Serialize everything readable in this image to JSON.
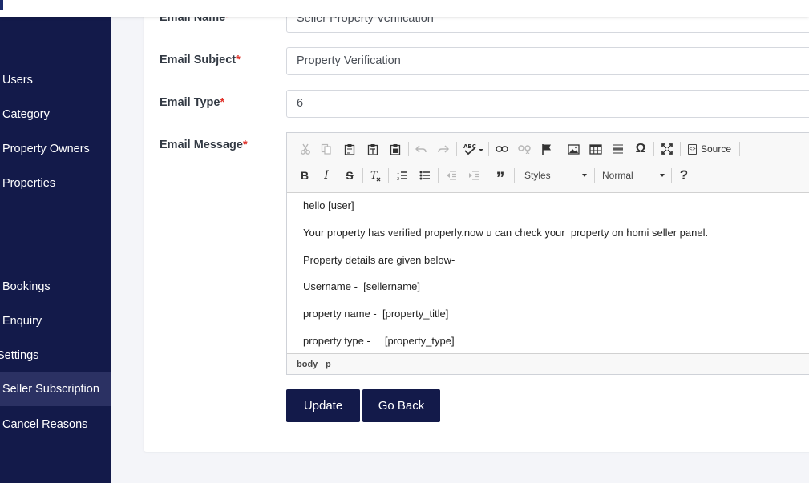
{
  "sidebar": {
    "items": [
      {
        "label": "Users"
      },
      {
        "label": "Category"
      },
      {
        "label": "Property Owners"
      },
      {
        "label": "Properties"
      },
      {
        "label": "Bookings"
      },
      {
        "label": "Enquiry"
      },
      {
        "label": "Settings"
      },
      {
        "label": "Seller Subscription",
        "active": true
      },
      {
        "label": "Cancel Reasons"
      }
    ]
  },
  "form": {
    "email_name": {
      "label": "Email Name",
      "required": "*",
      "value": "Seller Property Verification"
    },
    "email_subject": {
      "label": "Email Subject",
      "required": "*",
      "value": "Property Verification"
    },
    "email_type": {
      "label": "Email Type",
      "required": "*",
      "value": "6"
    },
    "email_message": {
      "label": "Email Message",
      "required": "*"
    }
  },
  "editor": {
    "toolbar": {
      "styles_label": "Styles",
      "format_label": "Normal",
      "source_label": "Source",
      "source_icon_text": "<>",
      "help_label": "?"
    },
    "content": [
      "hello [user]",
      "Your property has verified properly.now u can check your  property on homi seller panel.",
      "Property details are given below-",
      "Username -  [sellername]",
      "property name -  [property_title]",
      "property type -     [property_type]"
    ],
    "path": [
      "body",
      "p"
    ]
  },
  "buttons": {
    "update": "Update",
    "go_back": "Go Back"
  },
  "colors": {
    "sidebar_bg": "#131a4a",
    "sidebar_active": "#2b3163",
    "button_bg": "#131a4a",
    "required": "#e0342c"
  }
}
